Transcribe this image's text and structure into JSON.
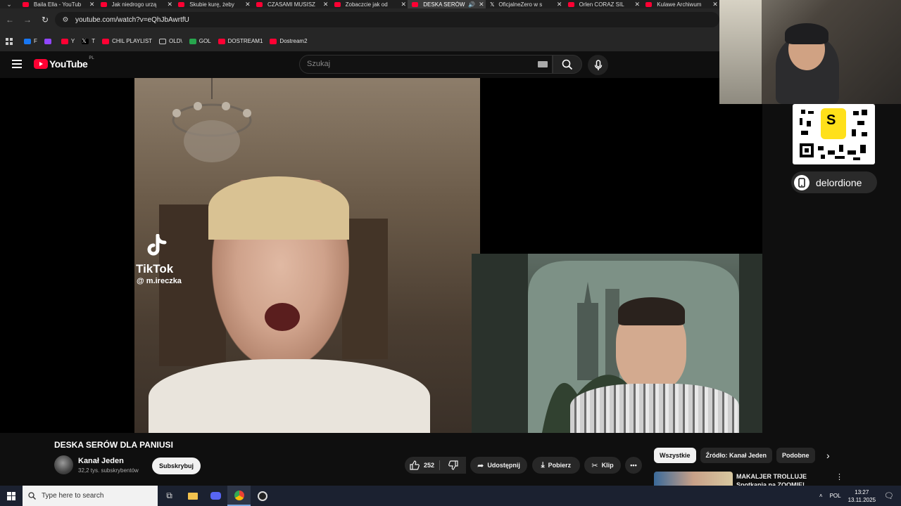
{
  "browser": {
    "tabs": [
      {
        "label": "Baila Ella - YouTub",
        "icon": "youtube-icon",
        "active": false
      },
      {
        "label": "Jak niedrogo urzą",
        "icon": "youtube-icon",
        "active": false
      },
      {
        "label": "Skubie kurę, żeby",
        "icon": "youtube-icon",
        "active": false
      },
      {
        "label": "CZASAMI MUSISZ",
        "icon": "youtube-icon",
        "active": false
      },
      {
        "label": "Zobaczcie jak od",
        "icon": "youtube-icon",
        "active": false
      },
      {
        "label": "DESKA SERÓW",
        "icon": "youtube-icon",
        "active": true
      },
      {
        "label": "OficjalneZero w s",
        "icon": "x-icon",
        "active": false
      },
      {
        "label": "Orlen CORAZ SIL",
        "icon": "youtube-icon",
        "active": false
      },
      {
        "label": "Kulawe Archiwum",
        "icon": "youtube-icon",
        "active": false
      }
    ],
    "url": "youtube.com/watch?v=eQhJbAwrtfU",
    "bookmarks": [
      {
        "label": "F",
        "icon": "facebook-icon",
        "color": "#1877f2"
      },
      {
        "label": "",
        "icon": "twitch-icon",
        "color": "#9146ff"
      },
      {
        "label": "Y",
        "icon": "youtube-icon",
        "color": "#ff0033"
      },
      {
        "label": "T",
        "icon": "x-icon",
        "color": "#000000"
      },
      {
        "label": "CHIL PLAYLIST",
        "icon": "youtube-icon",
        "color": "#ff0033"
      },
      {
        "label": "OLD\\",
        "icon": "folder-icon",
        "color": "#262626"
      },
      {
        "label": "GOL",
        "icon": "gol-icon",
        "color": "#27a54d"
      },
      {
        "label": "DOSTREAM1",
        "icon": "youtube-icon",
        "color": "#ff0033"
      },
      {
        "label": "Dostream2",
        "icon": "youtube-icon",
        "color": "#ff0033"
      }
    ]
  },
  "youtube": {
    "logo_text": "YouTube",
    "region": "PL",
    "search_placeholder": "Szukaj"
  },
  "video": {
    "title": "DESKA SERÓW DLA PANIUSI",
    "overlay_brand": "TikTok",
    "overlay_handle": "@ m.ireczka"
  },
  "stream_overlay": {
    "qr_letter": "S",
    "handle": "delordione"
  },
  "channel": {
    "name": "Kanał Jeden",
    "subs": "32,2 tys. subskrybentów",
    "subscribe_label": "Subskrybuj"
  },
  "actions": {
    "likes": "252",
    "share": "Udostępnij",
    "download": "Pobierz",
    "clip": "Klip"
  },
  "chips": [
    "Wszystkie",
    "Źródło: Kanał Jeden",
    "Podobne"
  ],
  "recommended": {
    "title": "MAKALJER TROLLUJE Spotkania na ZOOMIE!"
  },
  "taskbar": {
    "search_placeholder": "Type here to search",
    "lang": "POL",
    "time": "13:27",
    "date": "13.11.2025"
  }
}
